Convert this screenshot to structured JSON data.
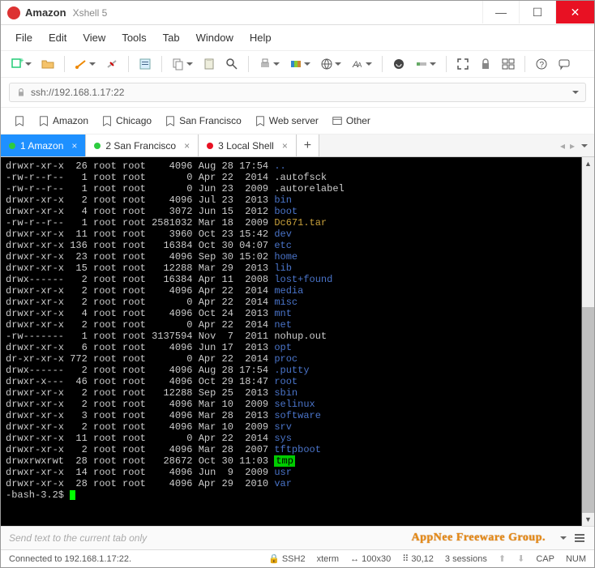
{
  "title": {
    "app": "Amazon",
    "sub": "Xshell 5"
  },
  "menu": [
    "File",
    "Edit",
    "View",
    "Tools",
    "Tab",
    "Window",
    "Help"
  ],
  "address": {
    "prefix_icon": "lock-icon",
    "text": "ssh://192.168.1.17:22"
  },
  "bookmarks": [
    "Amazon",
    "Chicago",
    "San Francisco",
    "Web server",
    "Other"
  ],
  "tabs": [
    {
      "label": "1 Amazon",
      "color": "#2ecc40",
      "active": true
    },
    {
      "label": "2 San Francisco",
      "color": "#2ecc40",
      "active": false
    },
    {
      "label": "3 Local Shell",
      "color": "#e81123",
      "active": false
    }
  ],
  "listing": [
    {
      "perm": "drwxr-xr-x",
      "links": "26",
      "owner": "root",
      "group": "root",
      "size": "4096",
      "date": "Aug 28 17:54",
      "name": "..",
      "cls": "blue"
    },
    {
      "perm": "-rw-r--r--",
      "links": "1",
      "owner": "root",
      "group": "root",
      "size": "0",
      "date": "Apr 22  2014",
      "name": ".autofsck",
      "cls": "white"
    },
    {
      "perm": "-rw-r--r--",
      "links": "1",
      "owner": "root",
      "group": "root",
      "size": "0",
      "date": "Jun 23  2009",
      "name": ".autorelabel",
      "cls": "white"
    },
    {
      "perm": "drwxr-xr-x",
      "links": "2",
      "owner": "root",
      "group": "root",
      "size": "4096",
      "date": "Jul 23  2013",
      "name": "bin",
      "cls": "blue"
    },
    {
      "perm": "drwxr-xr-x",
      "links": "4",
      "owner": "root",
      "group": "root",
      "size": "3072",
      "date": "Jun 15  2012",
      "name": "boot",
      "cls": "blue"
    },
    {
      "perm": "-rw-r--r--",
      "links": "1",
      "owner": "root",
      "group": "root",
      "size": "2581032",
      "date": "Mar 18  2009",
      "name": "Dc671.tar",
      "cls": "yellow"
    },
    {
      "perm": "drwxr-xr-x",
      "links": "11",
      "owner": "root",
      "group": "root",
      "size": "3960",
      "date": "Oct 23 15:42",
      "name": "dev",
      "cls": "blue"
    },
    {
      "perm": "drwxr-xr-x",
      "links": "136",
      "owner": "root",
      "group": "root",
      "size": "16384",
      "date": "Oct 30 04:07",
      "name": "etc",
      "cls": "blue"
    },
    {
      "perm": "drwxr-xr-x",
      "links": "23",
      "owner": "root",
      "group": "root",
      "size": "4096",
      "date": "Sep 30 15:02",
      "name": "home",
      "cls": "blue"
    },
    {
      "perm": "drwxr-xr-x",
      "links": "15",
      "owner": "root",
      "group": "root",
      "size": "12288",
      "date": "Mar 29  2013",
      "name": "lib",
      "cls": "blue"
    },
    {
      "perm": "drwx------",
      "links": "2",
      "owner": "root",
      "group": "root",
      "size": "16384",
      "date": "Apr 11  2008",
      "name": "lost+found",
      "cls": "blue"
    },
    {
      "perm": "drwxr-xr-x",
      "links": "2",
      "owner": "root",
      "group": "root",
      "size": "4096",
      "date": "Apr 22  2014",
      "name": "media",
      "cls": "blue"
    },
    {
      "perm": "drwxr-xr-x",
      "links": "2",
      "owner": "root",
      "group": "root",
      "size": "0",
      "date": "Apr 22  2014",
      "name": "misc",
      "cls": "blue"
    },
    {
      "perm": "drwxr-xr-x",
      "links": "4",
      "owner": "root",
      "group": "root",
      "size": "4096",
      "date": "Oct 24  2013",
      "name": "mnt",
      "cls": "blue"
    },
    {
      "perm": "drwxr-xr-x",
      "links": "2",
      "owner": "root",
      "group": "root",
      "size": "0",
      "date": "Apr 22  2014",
      "name": "net",
      "cls": "blue"
    },
    {
      "perm": "-rw-------",
      "links": "1",
      "owner": "root",
      "group": "root",
      "size": "3137594",
      "date": "Nov  7  2011",
      "name": "nohup.out",
      "cls": "white"
    },
    {
      "perm": "drwxr-xr-x",
      "links": "6",
      "owner": "root",
      "group": "root",
      "size": "4096",
      "date": "Jun 17  2013",
      "name": "opt",
      "cls": "blue"
    },
    {
      "perm": "dr-xr-xr-x",
      "links": "772",
      "owner": "root",
      "group": "root",
      "size": "0",
      "date": "Apr 22  2014",
      "name": "proc",
      "cls": "blue"
    },
    {
      "perm": "drwx------",
      "links": "2",
      "owner": "root",
      "group": "root",
      "size": "4096",
      "date": "Aug 28 17:54",
      "name": ".putty",
      "cls": "blue"
    },
    {
      "perm": "drwxr-x---",
      "links": "46",
      "owner": "root",
      "group": "root",
      "size": "4096",
      "date": "Oct 29 18:47",
      "name": "root",
      "cls": "blue"
    },
    {
      "perm": "drwxr-xr-x",
      "links": "2",
      "owner": "root",
      "group": "root",
      "size": "12288",
      "date": "Sep 25  2013",
      "name": "sbin",
      "cls": "blue"
    },
    {
      "perm": "drwxr-xr-x",
      "links": "2",
      "owner": "root",
      "group": "root",
      "size": "4096",
      "date": "Mar 10  2009",
      "name": "selinux",
      "cls": "blue"
    },
    {
      "perm": "drwxr-xr-x",
      "links": "3",
      "owner": "root",
      "group": "root",
      "size": "4096",
      "date": "Mar 28  2013",
      "name": "software",
      "cls": "blue"
    },
    {
      "perm": "drwxr-xr-x",
      "links": "2",
      "owner": "root",
      "group": "root",
      "size": "4096",
      "date": "Mar 10  2009",
      "name": "srv",
      "cls": "blue"
    },
    {
      "perm": "drwxr-xr-x",
      "links": "11",
      "owner": "root",
      "group": "root",
      "size": "0",
      "date": "Apr 22  2014",
      "name": "sys",
      "cls": "blue"
    },
    {
      "perm": "drwxr-xr-x",
      "links": "2",
      "owner": "root",
      "group": "root",
      "size": "4096",
      "date": "Mar 28  2007",
      "name": "tftpboot",
      "cls": "blue"
    },
    {
      "perm": "drwxrwxrwt",
      "links": "28",
      "owner": "root",
      "group": "root",
      "size": "28672",
      "date": "Oct 30 11:03",
      "name": "tmp",
      "cls": "green-bg"
    },
    {
      "perm": "drwxr-xr-x",
      "links": "14",
      "owner": "root",
      "group": "root",
      "size": "4096",
      "date": "Jun  9  2009",
      "name": "usr",
      "cls": "blue"
    },
    {
      "perm": "drwxr-xr-x",
      "links": "28",
      "owner": "root",
      "group": "root",
      "size": "4096",
      "date": "Apr 29  2010",
      "name": "var",
      "cls": "blue"
    }
  ],
  "prompt": "-bash-3.2$ ",
  "send_placeholder": "Send text to the current tab only",
  "watermark": "AppNee Freeware Group.",
  "status": {
    "conn": "Connected to 192.168.1.17:22.",
    "proto": "SSH2",
    "term": "xterm",
    "size": "100x30",
    "pos": "30,12",
    "sessions": "3 sessions",
    "cap": "CAP",
    "num": "NUM"
  }
}
